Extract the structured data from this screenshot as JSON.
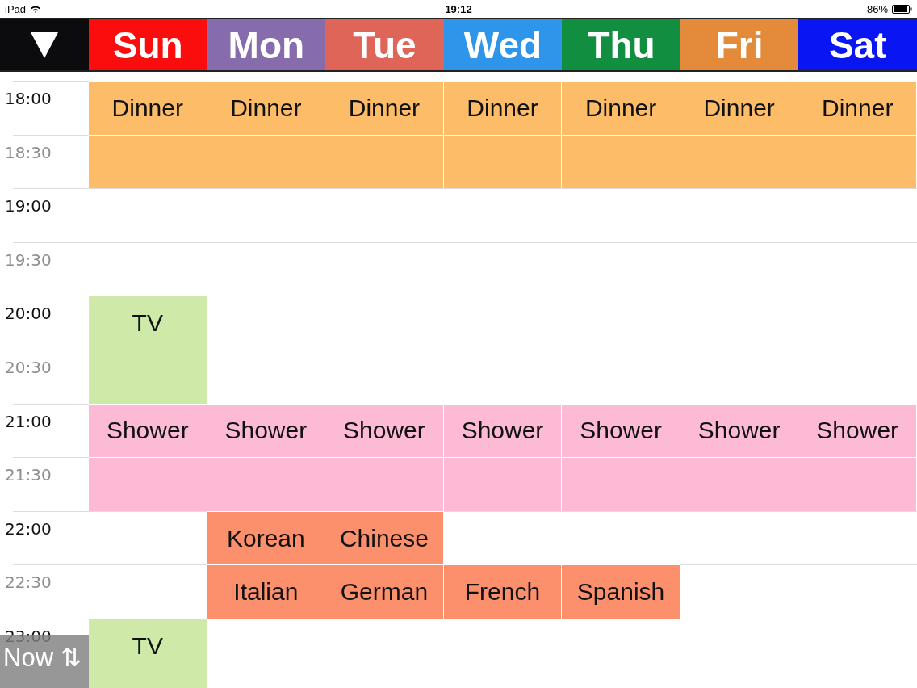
{
  "status_bar": {
    "device": "iPad",
    "time": "19:12",
    "battery": "86%"
  },
  "days": [
    {
      "label": "Sun",
      "color": "#fc0d0d"
    },
    {
      "label": "Mon",
      "color": "#876cad"
    },
    {
      "label": "Tue",
      "color": "#df6558"
    },
    {
      "label": "Wed",
      "color": "#2f95eb"
    },
    {
      "label": "Thu",
      "color": "#118e3f"
    },
    {
      "label": "Fri",
      "color": "#e38a3b"
    },
    {
      "label": "Sat",
      "color": "#0a16f2"
    }
  ],
  "rows": [
    {
      "time": "18:00",
      "kind": "hour",
      "cells": [
        {
          "kind": "event",
          "label": "Dinner",
          "color": "#fdbc68"
        },
        {
          "kind": "event",
          "label": "Dinner",
          "color": "#fdbc68"
        },
        {
          "kind": "event",
          "label": "Dinner",
          "color": "#fdbc68"
        },
        {
          "kind": "event",
          "label": "Dinner",
          "color": "#fdbc68"
        },
        {
          "kind": "event",
          "label": "Dinner",
          "color": "#fdbc68"
        },
        {
          "kind": "event",
          "label": "Dinner",
          "color": "#fdbc68"
        },
        {
          "kind": "event",
          "label": "Dinner",
          "color": "#fdbc68"
        }
      ]
    },
    {
      "time": "18:30",
      "kind": "half",
      "cells": [
        {
          "kind": "more",
          "color": "#fdbc68"
        },
        {
          "kind": "more",
          "color": "#fdbc68"
        },
        {
          "kind": "more",
          "color": "#fdbc68"
        },
        {
          "kind": "more",
          "color": "#fdbc68"
        },
        {
          "kind": "more",
          "color": "#fdbc68"
        },
        {
          "kind": "more",
          "color": "#fdbc68"
        },
        {
          "kind": "more",
          "color": "#fdbc68"
        }
      ]
    },
    {
      "time": "19:00",
      "kind": "hour",
      "cells": [
        {
          "kind": "empty"
        },
        {
          "kind": "empty"
        },
        {
          "kind": "empty"
        },
        {
          "kind": "empty"
        },
        {
          "kind": "empty"
        },
        {
          "kind": "empty"
        },
        {
          "kind": "empty"
        }
      ]
    },
    {
      "time": "19:30",
      "kind": "half",
      "cells": [
        {
          "kind": "empty"
        },
        {
          "kind": "empty"
        },
        {
          "kind": "empty"
        },
        {
          "kind": "empty"
        },
        {
          "kind": "empty"
        },
        {
          "kind": "empty"
        },
        {
          "kind": "empty"
        }
      ]
    },
    {
      "time": "20:00",
      "kind": "hour",
      "cells": [
        {
          "kind": "event",
          "label": "TV",
          "color": "#cfeaa8"
        },
        {
          "kind": "empty"
        },
        {
          "kind": "empty"
        },
        {
          "kind": "empty"
        },
        {
          "kind": "empty"
        },
        {
          "kind": "empty"
        },
        {
          "kind": "empty"
        }
      ]
    },
    {
      "time": "20:30",
      "kind": "half",
      "cells": [
        {
          "kind": "more",
          "color": "#cfeaa8"
        },
        {
          "kind": "empty"
        },
        {
          "kind": "empty"
        },
        {
          "kind": "empty"
        },
        {
          "kind": "empty"
        },
        {
          "kind": "empty"
        },
        {
          "kind": "empty"
        }
      ]
    },
    {
      "time": "21:00",
      "kind": "hour",
      "cells": [
        {
          "kind": "event",
          "label": "Shower",
          "color": "#fdbad5"
        },
        {
          "kind": "event",
          "label": "Shower",
          "color": "#fdbad5"
        },
        {
          "kind": "event",
          "label": "Shower",
          "color": "#fdbad5"
        },
        {
          "kind": "event",
          "label": "Shower",
          "color": "#fdbad5"
        },
        {
          "kind": "event",
          "label": "Shower",
          "color": "#fdbad5"
        },
        {
          "kind": "event",
          "label": "Shower",
          "color": "#fdbad5"
        },
        {
          "kind": "event",
          "label": "Shower",
          "color": "#fdbad5"
        }
      ]
    },
    {
      "time": "21:30",
      "kind": "half",
      "cells": [
        {
          "kind": "more",
          "color": "#fdbad5"
        },
        {
          "kind": "more",
          "color": "#fdbad5"
        },
        {
          "kind": "more",
          "color": "#fdbad5"
        },
        {
          "kind": "more",
          "color": "#fdbad5"
        },
        {
          "kind": "more",
          "color": "#fdbad5"
        },
        {
          "kind": "more",
          "color": "#fdbad5"
        },
        {
          "kind": "more",
          "color": "#fdbad5"
        }
      ]
    },
    {
      "time": "22:00",
      "kind": "hour",
      "cells": [
        {
          "kind": "empty"
        },
        {
          "kind": "event",
          "label": "Korean",
          "color": "#fd906c"
        },
        {
          "kind": "event",
          "label": "Chinese",
          "color": "#fd906c"
        },
        {
          "kind": "empty"
        },
        {
          "kind": "empty"
        },
        {
          "kind": "empty"
        },
        {
          "kind": "empty"
        }
      ]
    },
    {
      "time": "22:30",
      "kind": "half",
      "cells": [
        {
          "kind": "empty"
        },
        {
          "kind": "event",
          "label": "Italian",
          "color": "#fd906c"
        },
        {
          "kind": "event",
          "label": "German",
          "color": "#fd906c"
        },
        {
          "kind": "event",
          "label": "French",
          "color": "#fd906c"
        },
        {
          "kind": "event",
          "label": "Spanish",
          "color": "#fd906c"
        },
        {
          "kind": "empty"
        },
        {
          "kind": "empty"
        }
      ]
    },
    {
      "time": "23:00",
      "kind": "hour",
      "cells": [
        {
          "kind": "event",
          "label": "TV",
          "color": "#cfeaa8"
        },
        {
          "kind": "empty"
        },
        {
          "kind": "empty"
        },
        {
          "kind": "empty"
        },
        {
          "kind": "empty"
        },
        {
          "kind": "empty"
        },
        {
          "kind": "empty"
        }
      ]
    },
    {
      "kind": "half",
      "cells": [
        {
          "kind": "more",
          "color": "#cfeaa8"
        },
        {
          "kind": "empty"
        },
        {
          "kind": "empty"
        },
        {
          "kind": "empty"
        },
        {
          "kind": "empty"
        },
        {
          "kind": "empty"
        },
        {
          "kind": "empty"
        }
      ]
    }
  ],
  "now_button": {
    "label": "Now",
    "icon": "⇅"
  }
}
